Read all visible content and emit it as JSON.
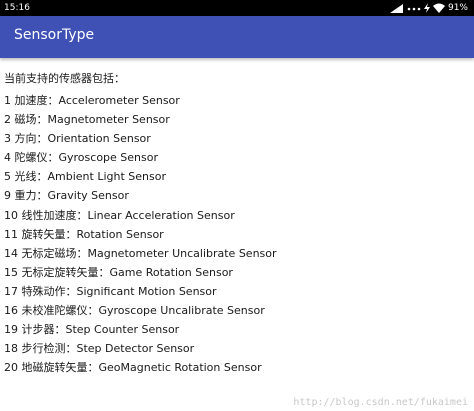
{
  "status_bar": {
    "time": "15:16",
    "battery": "91%",
    "icons": [
      "signal-icon",
      "dots-icon",
      "bolt-icon",
      "wifi-icon"
    ]
  },
  "app_bar": {
    "title": "SensorType",
    "color": "#3f51b5"
  },
  "content": {
    "intro": "当前支持的传感器包括：",
    "sensors": [
      "1 加速度：Accelerometer Sensor",
      "2 磁场：Magnetometer Sensor",
      "3 方向：Orientation Sensor",
      "4 陀螺仪：Gyroscope Sensor",
      "5 光线：Ambient Light Sensor",
      "9 重力：Gravity Sensor",
      "10 线性加速度：Linear Acceleration Sensor",
      "11 旋转矢量：Rotation Sensor",
      "14 无标定磁场：Magnetometer Uncalibrate Sensor",
      "15 无标定旋转矢量：Game Rotation Sensor",
      "17 特殊动作：Significant Motion Sensor",
      "16 未校准陀螺仪：Gyroscope Uncalibrate Sensor",
      "19 计步器：Step Counter Sensor",
      "18 步行检测：Step Detector Sensor",
      "20 地磁旋转矢量：GeoMagnetic Rotation Sensor"
    ]
  },
  "watermark": "http://blog.csdn.net/fukaimei"
}
